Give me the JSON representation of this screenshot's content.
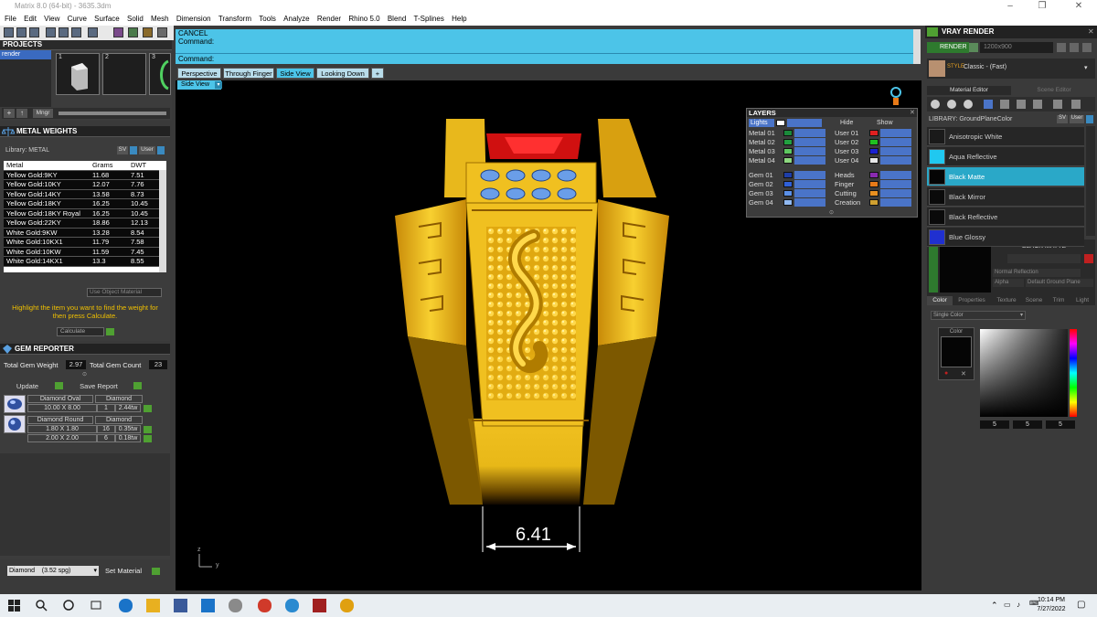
{
  "window": {
    "title": "Matrix 8.0 (64-bit) - 3635.3dm"
  },
  "menu": [
    "File",
    "Edit",
    "View",
    "Curve",
    "Surface",
    "Solid",
    "Mesh",
    "Dimension",
    "Transform",
    "Tools",
    "Analyze",
    "Render",
    "Rhino 5.0",
    "Blend",
    "T-Splines",
    "Help"
  ],
  "projects": {
    "title": "PROJECTS",
    "list_item": "render",
    "thumbs": [
      "1",
      "2",
      "3"
    ],
    "mngr": "Mngr"
  },
  "metal_weights": {
    "title": "METAL WEIGHTS",
    "library_label": "Library: METAL",
    "sv_label": "SV",
    "user_label": "User",
    "columns": [
      "Metal",
      "Grams",
      "DWT"
    ],
    "rows": [
      [
        "Yellow Gold:9KY",
        "11.68",
        "7.51"
      ],
      [
        "Yellow Gold:10KY",
        "12.07",
        "7.76"
      ],
      [
        "Yellow Gold:14KY",
        "13.58",
        "8.73"
      ],
      [
        "Yellow Gold:18KY",
        "16.25",
        "10.45"
      ],
      [
        "Yellow Gold:18KY Royal",
        "16.25",
        "10.45"
      ],
      [
        "Yellow Gold:22KY",
        "18.86",
        "12.13"
      ],
      [
        "White Gold:9KW",
        "13.28",
        "8.54"
      ],
      [
        "White Gold:10KX1",
        "11.79",
        "7.58"
      ],
      [
        "White Gold:10KW",
        "11.59",
        "7.45"
      ],
      [
        "White Gold:14KX1",
        "13.3",
        "8.55"
      ]
    ],
    "use_object_material": "Use Object Material",
    "hint": "Highlight the item you want to find the weight for then press Calculate.",
    "calculate": "Calculate"
  },
  "gem_reporter": {
    "title": "GEM REPORTER",
    "total_weight_label": "Total Gem Weight",
    "total_weight": "2.97",
    "total_count_label": "Total Gem Count",
    "total_count": "23",
    "update": "Update",
    "save_report": "Save Report",
    "groups": [
      {
        "name": "Diamond Oval",
        "type": "Diamond",
        "rows": [
          [
            "10.00 X 8.00",
            "1",
            "2.44tw"
          ]
        ]
      },
      {
        "name": "Diamond Round",
        "type": "Diamond",
        "rows": [
          [
            "1.80 X 1.80",
            "16",
            "0.35tw"
          ],
          [
            "2.00 X 2.00",
            "6",
            "0.18tw"
          ]
        ]
      }
    ],
    "material_select": "Diamond",
    "material_sg": "(3.52 spg)",
    "set_material": "Set Material"
  },
  "command": {
    "cancel": "CANCEL",
    "line1": "Command:",
    "prompt": "Command:"
  },
  "view_tabs": [
    "Perspective",
    "Through Finger",
    "Side View",
    "Looking Down"
  ],
  "active_view": "Side View",
  "viewport": {
    "dimension": "6.41",
    "axis_z": "z",
    "axis_y": "y"
  },
  "layers": {
    "title": "LAYERS",
    "lights": "Lights",
    "hide": "Hide",
    "show": "Show",
    "left": [
      {
        "name": "Metal 01",
        "color": "#1a8a3a"
      },
      {
        "name": "Metal 02",
        "color": "#22a040"
      },
      {
        "name": "Metal 03",
        "color": "#5ec860"
      },
      {
        "name": "Metal 04",
        "color": "#8ed880"
      },
      {
        "name": "Gem 01",
        "color": "#1e3ea8"
      },
      {
        "name": "Gem 02",
        "color": "#2f60d8"
      },
      {
        "name": "Gem 03",
        "color": "#5a90e8"
      },
      {
        "name": "Gem 04",
        "color": "#90b8f0"
      }
    ],
    "right": [
      {
        "name": "User 01",
        "color": "#e02020"
      },
      {
        "name": "User 02",
        "color": "#20c020"
      },
      {
        "name": "User 03",
        "color": "#1a20d0"
      },
      {
        "name": "User 04",
        "color": "#e8e8e8"
      },
      {
        "name": "Heads",
        "color": "#8a2ab0"
      },
      {
        "name": "Finger",
        "color": "#e87a18"
      },
      {
        "name": "Cutting",
        "color": "#e89020"
      },
      {
        "name": "Creation",
        "color": "#d0a030"
      }
    ]
  },
  "vray": {
    "title": "VRAY RENDER",
    "render_btn": "RENDER",
    "resolution": "1200x900",
    "preset_label": "STYLE",
    "preset": "Classic - (Fast)",
    "tabs": [
      "Material Editor",
      "Scene Editor"
    ],
    "library": "LIBRARY: GroundPlaneColor",
    "sv": "SV",
    "user": "User",
    "materials": [
      {
        "name": "Anisotropic White",
        "color": "#1a1a1a"
      },
      {
        "name": "Aqua Reflective",
        "color": "#20c8f0"
      },
      {
        "name": "Black Matte",
        "color": "#050505"
      },
      {
        "name": "Black Mirror",
        "color": "#0a0a0a"
      },
      {
        "name": "Black Reflective",
        "color": "#0a0a0a"
      },
      {
        "name": "Blue Glossy",
        "color": "#2030d0"
      }
    ],
    "selected_material": "Black Matte",
    "selected_title": "BLACK MATTE",
    "reflection": "Normal Reflection",
    "alpha": "Alpha",
    "ground": "Default Ground Plane",
    "lower_tabs": [
      "Color",
      "Properties",
      "Texture",
      "Scene",
      "Trim",
      "Light"
    ],
    "color_mode": "Single Color",
    "color_label": "Color",
    "rgb": [
      "5",
      "5",
      "5"
    ]
  },
  "taskbar": {
    "time": "10:14 PM",
    "date": "7/27/2022"
  },
  "colors": {
    "accent_cyan": "#4cc4e8",
    "gold": "#e8b81c",
    "green_btn": "#4fa032",
    "highlight_text": "#f0c000"
  }
}
